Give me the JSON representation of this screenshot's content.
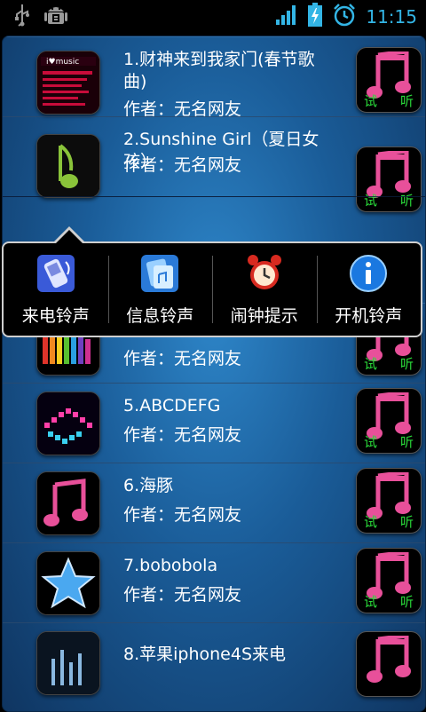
{
  "status_bar": {
    "time": "11:15",
    "icons": [
      "usb-icon",
      "android-debug-icon",
      "signal-icon",
      "battery-charging-icon",
      "alarm-icon"
    ],
    "time_color": "#33b5e5"
  },
  "songs": [
    {
      "title": "1.财神来到我家门(春节歌曲)",
      "author": "作者：无名网友",
      "thumb": "imusic-cover"
    },
    {
      "title": "2.Sunshine Girl（夏日女孩）",
      "author": "作者：无名网友",
      "thumb": "green-note"
    },
    {
      "title": "",
      "author": "",
      "thumb": "hidden"
    },
    {
      "title": "",
      "author": "作者：无名网友",
      "thumb": "rainbow-bars"
    },
    {
      "title": "5.ABCDEFG",
      "author": "作者：无名网友",
      "thumb": "pink-equalizer"
    },
    {
      "title": "6.海豚",
      "author": "作者：无名网友",
      "thumb": "pink-note"
    },
    {
      "title": "7.bobobola",
      "author": "作者：无名网友",
      "thumb": "blue-star"
    },
    {
      "title": "8.苹果iphone4S来电",
      "author": "",
      "thumb": "iphone-dark"
    }
  ],
  "listen_label": {
    "left": "试",
    "right": "听"
  },
  "popup_menu": {
    "items": [
      {
        "label": "来电铃声",
        "icon": "phone-ringtone-icon"
      },
      {
        "label": "信息铃声",
        "icon": "message-ringtone-icon"
      },
      {
        "label": "闹钟提示",
        "icon": "alarm-clock-icon"
      },
      {
        "label": "开机铃声",
        "icon": "info-icon"
      }
    ]
  },
  "colors": {
    "listen_text": "#2adb3a",
    "note_pink": "#e8509a",
    "panel_blue": "#1a5c98"
  }
}
